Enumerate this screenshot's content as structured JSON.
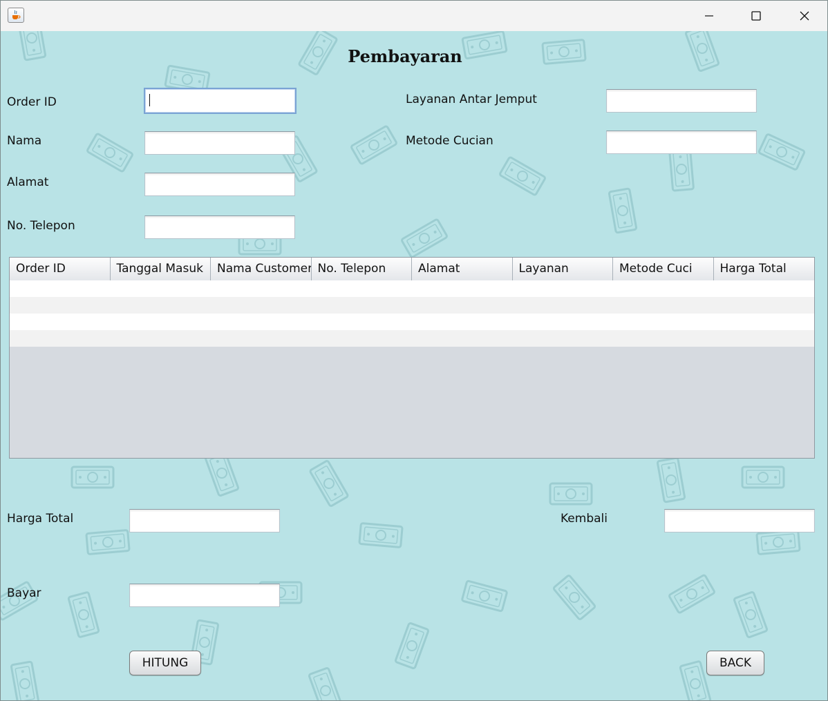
{
  "window": {
    "icon": "java-cup-icon",
    "controls": {
      "minimize": "minimize-icon",
      "maximize": "maximize-icon",
      "close": "close-icon"
    }
  },
  "page": {
    "title": "Pembayaran"
  },
  "form": {
    "order_id": {
      "label": "Order ID",
      "value": ""
    },
    "nama": {
      "label": "Nama",
      "value": ""
    },
    "alamat": {
      "label": "Alamat",
      "value": ""
    },
    "telepon": {
      "label": "No. Telepon",
      "value": ""
    },
    "antar_jemput": {
      "label": "Layanan Antar Jemput",
      "value": ""
    },
    "metode_cucian": {
      "label": "Metode Cucian",
      "value": ""
    }
  },
  "table": {
    "columns": [
      "Order ID",
      "Tanggal Masuk",
      "Nama Customer",
      "No. Telepon",
      "Alamat",
      "Layanan",
      "Metode Cuci",
      "Harga Total"
    ],
    "rows": []
  },
  "payment": {
    "harga_total": {
      "label": "Harga Total",
      "value": ""
    },
    "bayar": {
      "label": "Bayar",
      "value": ""
    },
    "kembali": {
      "label": "Kembali",
      "value": ""
    }
  },
  "buttons": {
    "hitung": "HITUNG",
    "back": "BACK"
  },
  "colors": {
    "background": "#b9e3e6",
    "titlebar": "#f3f3f3",
    "focus_border": "#7aa3d4",
    "table_empty": "#d6dae0"
  }
}
